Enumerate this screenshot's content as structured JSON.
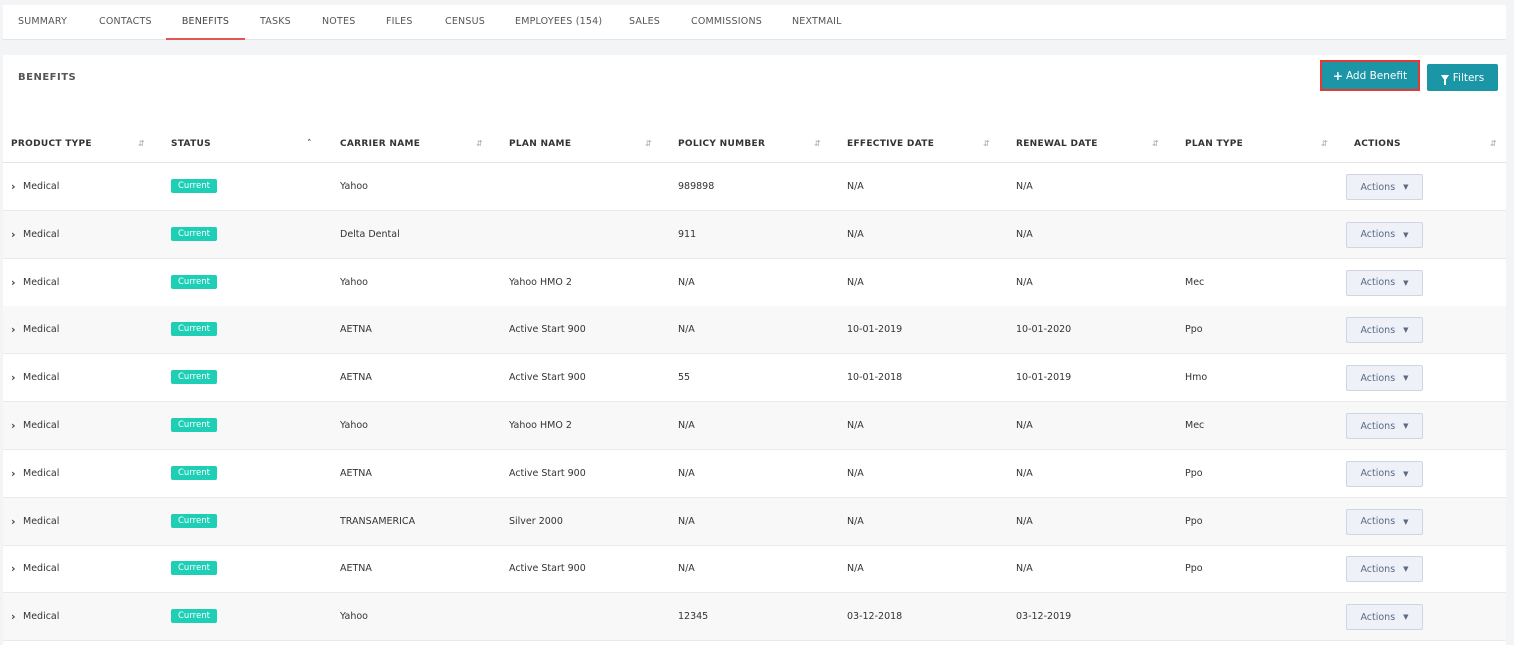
{
  "tabs": [
    {
      "label": "SUMMARY"
    },
    {
      "label": "CONTACTS"
    },
    {
      "label": "BENEFITS"
    },
    {
      "label": "TASKS"
    },
    {
      "label": "NOTES"
    },
    {
      "label": "FILES"
    },
    {
      "label": "CENSUS"
    },
    {
      "label": "EMPLOYEES (154)"
    },
    {
      "label": "SALES"
    },
    {
      "label": "COMMISSIONS"
    },
    {
      "label": "NEXTMAIL"
    }
  ],
  "active_tab": "BENEFITS",
  "panel": {
    "title": "BENEFITS",
    "add_label": "Add Benefit",
    "filters_label": "Filters"
  },
  "colors": {
    "accent": "#1a96a6",
    "badge": "#1ecfb6",
    "highlight": "#e53935"
  },
  "columns": [
    {
      "label": "PRODUCT TYPE"
    },
    {
      "label": "STATUS"
    },
    {
      "label": "CARRIER NAME"
    },
    {
      "label": "PLAN NAME"
    },
    {
      "label": "POLICY NUMBER"
    },
    {
      "label": "EFFECTIVE DATE"
    },
    {
      "label": "RENEWAL DATE"
    },
    {
      "label": "PLAN TYPE"
    },
    {
      "label": "ACTIONS"
    }
  ],
  "rows": [
    {
      "product": "Medical",
      "status": "Current",
      "carrier": "Yahoo",
      "plan": "",
      "policy": "989898",
      "effective": "N/A",
      "renewal": "N/A",
      "plan_type": "",
      "actions": "Actions"
    },
    {
      "product": "Medical",
      "status": "Current",
      "carrier": "Delta Dental",
      "plan": "",
      "policy": "911",
      "effective": "N/A",
      "renewal": "N/A",
      "plan_type": "",
      "actions": "Actions"
    },
    {
      "product": "Medical",
      "status": "Current",
      "carrier": "Yahoo",
      "plan": "Yahoo HMO 2",
      "policy": "N/A",
      "effective": "N/A",
      "renewal": "N/A",
      "plan_type": "Mec",
      "actions": "Actions"
    },
    {
      "product": "Medical",
      "status": "Current",
      "carrier": "AETNA",
      "plan": "Active Start 900",
      "policy": "N/A",
      "effective": "10-01-2019",
      "renewal": "10-01-2020",
      "plan_type": "Ppo",
      "actions": "Actions"
    },
    {
      "product": "Medical",
      "status": "Current",
      "carrier": "AETNA",
      "plan": "Active Start 900",
      "policy": "55",
      "effective": "10-01-2018",
      "renewal": "10-01-2019",
      "plan_type": "Hmo",
      "actions": "Actions"
    },
    {
      "product": "Medical",
      "status": "Current",
      "carrier": "Yahoo",
      "plan": "Yahoo HMO 2",
      "policy": "N/A",
      "effective": "N/A",
      "renewal": "N/A",
      "plan_type": "Mec",
      "actions": "Actions"
    },
    {
      "product": "Medical",
      "status": "Current",
      "carrier": "AETNA",
      "plan": "Active Start 900",
      "policy": "N/A",
      "effective": "N/A",
      "renewal": "N/A",
      "plan_type": "Ppo",
      "actions": "Actions"
    },
    {
      "product": "Medical",
      "status": "Current",
      "carrier": "TRANSAMERICA",
      "plan": "Silver 2000",
      "policy": "N/A",
      "effective": "N/A",
      "renewal": "N/A",
      "plan_type": "Ppo",
      "actions": "Actions"
    },
    {
      "product": "Medical",
      "status": "Current",
      "carrier": "AETNA",
      "plan": "Active Start 900",
      "policy": "N/A",
      "effective": "N/A",
      "renewal": "N/A",
      "plan_type": "Ppo",
      "actions": "Actions"
    },
    {
      "product": "Medical",
      "status": "Current",
      "carrier": "Yahoo",
      "plan": "",
      "policy": "12345",
      "effective": "03-12-2018",
      "renewal": "03-12-2019",
      "plan_type": "",
      "actions": "Actions"
    }
  ]
}
